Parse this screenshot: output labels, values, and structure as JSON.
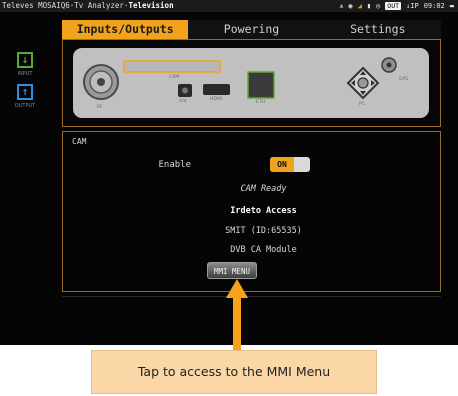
{
  "status_bar": {
    "app_prefix": "Televes MOSAIQ6·Tv Analyzer·",
    "app_mode": "Television",
    "out_badge": "OUT",
    "ip_label": "↓IP",
    "time": "09:02",
    "icons": [
      "antenna-icon",
      "record-icon",
      "signal-icon",
      "sd-card-icon",
      "gps-icon",
      "battery-icon"
    ]
  },
  "tabs": [
    {
      "label": "Inputs/Outputs",
      "active": true
    },
    {
      "label": "Powering",
      "active": false
    },
    {
      "label": "Settings",
      "active": false
    }
  ],
  "sidebar": {
    "input_label": "INPUT",
    "output_label": "OUTPUT"
  },
  "device_panel": {
    "ports": {
      "rf": "RF",
      "cam": "CAM",
      "av": "A/V",
      "hdmi": "HDMI",
      "eth": "ETH",
      "pc": "PC",
      "gps": "GPS"
    }
  },
  "cam_panel": {
    "title": "CAM",
    "enable_label": "Enable",
    "toggle_value": "ON",
    "status": "CAM Ready",
    "provider": "Irdeto Access",
    "smit": "SMIT (ID:65535)",
    "module": "DVB CA Module",
    "mmi_button": "MMI MENU"
  },
  "callout": {
    "text": "Tap to access to the MMI Menu"
  },
  "colors": {
    "accent": "#f2a31c",
    "frame": "#9b6b2c",
    "input_green": "#5caa32",
    "output_blue": "#2f8fe0",
    "callout_bg": "#fbd7a8"
  }
}
